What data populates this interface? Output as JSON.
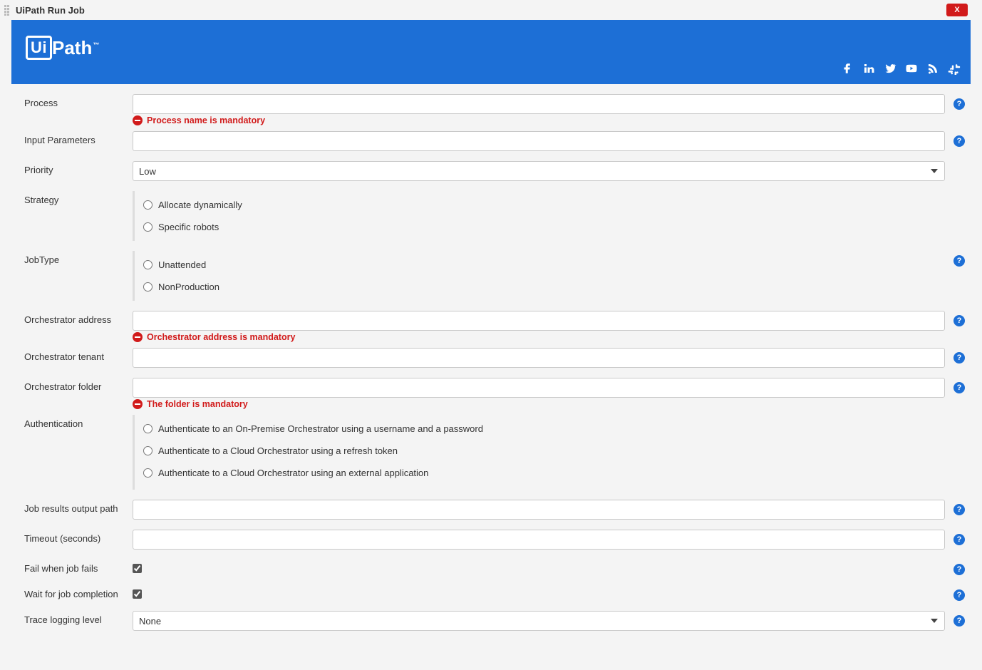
{
  "window": {
    "title": "UiPath Run Job"
  },
  "banner": {
    "logo_box": "Ui",
    "logo_rest": "Path"
  },
  "labels": {
    "process": "Process",
    "input_params": "Input Parameters",
    "priority": "Priority",
    "strategy": "Strategy",
    "job_type": "JobType",
    "orch_address": "Orchestrator address",
    "orch_tenant": "Orchestrator tenant",
    "orch_folder": "Orchestrator folder",
    "authentication": "Authentication",
    "job_results_path": "Job results output path",
    "timeout": "Timeout (seconds)",
    "fail_when_fails": "Fail when job fails",
    "wait_completion": "Wait for job completion",
    "trace_level": "Trace logging level"
  },
  "values": {
    "process": "",
    "input_params": "",
    "priority_selected": "Low",
    "orch_address": "",
    "orch_tenant": "",
    "orch_folder": "",
    "job_results_path": "",
    "timeout": "",
    "fail_when_fails": true,
    "wait_completion": true,
    "trace_level_selected": "None"
  },
  "options": {
    "strategy": [
      "Allocate dynamically",
      "Specific robots"
    ],
    "job_type": [
      "Unattended",
      "NonProduction"
    ],
    "authentication": [
      "Authenticate to an On-Premise Orchestrator using a username and a password",
      "Authenticate to a Cloud Orchestrator using a refresh token",
      "Authenticate to a Cloud Orchestrator using an external application"
    ]
  },
  "errors": {
    "process": "Process name is mandatory",
    "orch_address": "Orchestrator address is mandatory",
    "orch_folder": "The folder is mandatory"
  },
  "help_glyph": "?"
}
